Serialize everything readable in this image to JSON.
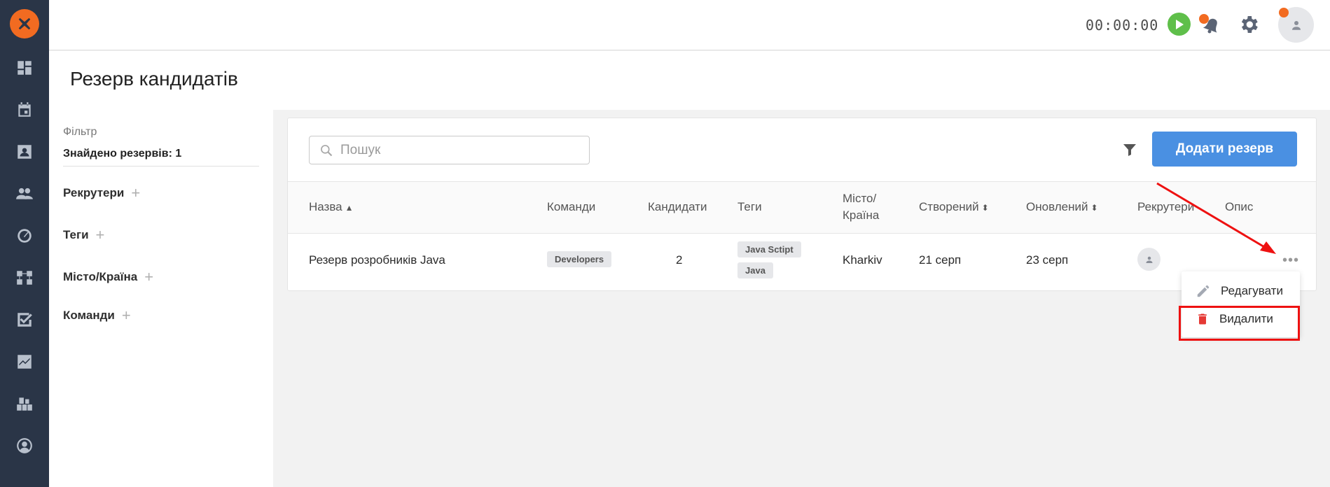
{
  "colors": {
    "sidebar_bg": "#2a3547",
    "brand": "#f26b21",
    "primary_button": "#4a90e2",
    "play_green": "#5fbf4a",
    "danger": "#e53935",
    "annotation": "#e11111"
  },
  "sidebar": {
    "logo_icon": "logo-x-icon",
    "items": [
      {
        "icon": "dashboard-icon"
      },
      {
        "icon": "calendar-icon"
      },
      {
        "icon": "contacts-icon"
      },
      {
        "icon": "people-icon"
      },
      {
        "icon": "speed-icon"
      },
      {
        "icon": "workflow-icon"
      },
      {
        "icon": "checkbox-icon"
      },
      {
        "icon": "chart-icon"
      },
      {
        "icon": "boxes-icon"
      },
      {
        "icon": "account-icon"
      }
    ]
  },
  "topbar": {
    "timer": "00:00:00"
  },
  "header": {
    "title": "Резерв кандидатів"
  },
  "filter": {
    "label": "Фільтр",
    "found": "Знайдено резервів: 1",
    "groups": [
      "Рекрутери",
      "Теги",
      "Місто/Країна",
      "Команди"
    ]
  },
  "toolbar": {
    "search_placeholder": "Пошук",
    "add_button": "Додати резерв"
  },
  "table": {
    "columns": {
      "name": "Назва",
      "teams": "Команди",
      "candidates": "Кандидати",
      "tags": "Теги",
      "city_line1": "Місто/",
      "city_line2": "Країна",
      "created": "Створений",
      "updated": "Оновлений",
      "recruiters": "Рекрутери",
      "description": "Опис"
    },
    "rows": [
      {
        "name": "Резерв розробників Java",
        "team": "Developers",
        "candidates": "2",
        "tags": [
          "Java Sctipt",
          "Java"
        ],
        "city": "Kharkiv",
        "created": "21 серп",
        "updated": "23 серп"
      }
    ]
  },
  "row_menu": {
    "edit": "Редагувати",
    "delete": "Видалити"
  }
}
